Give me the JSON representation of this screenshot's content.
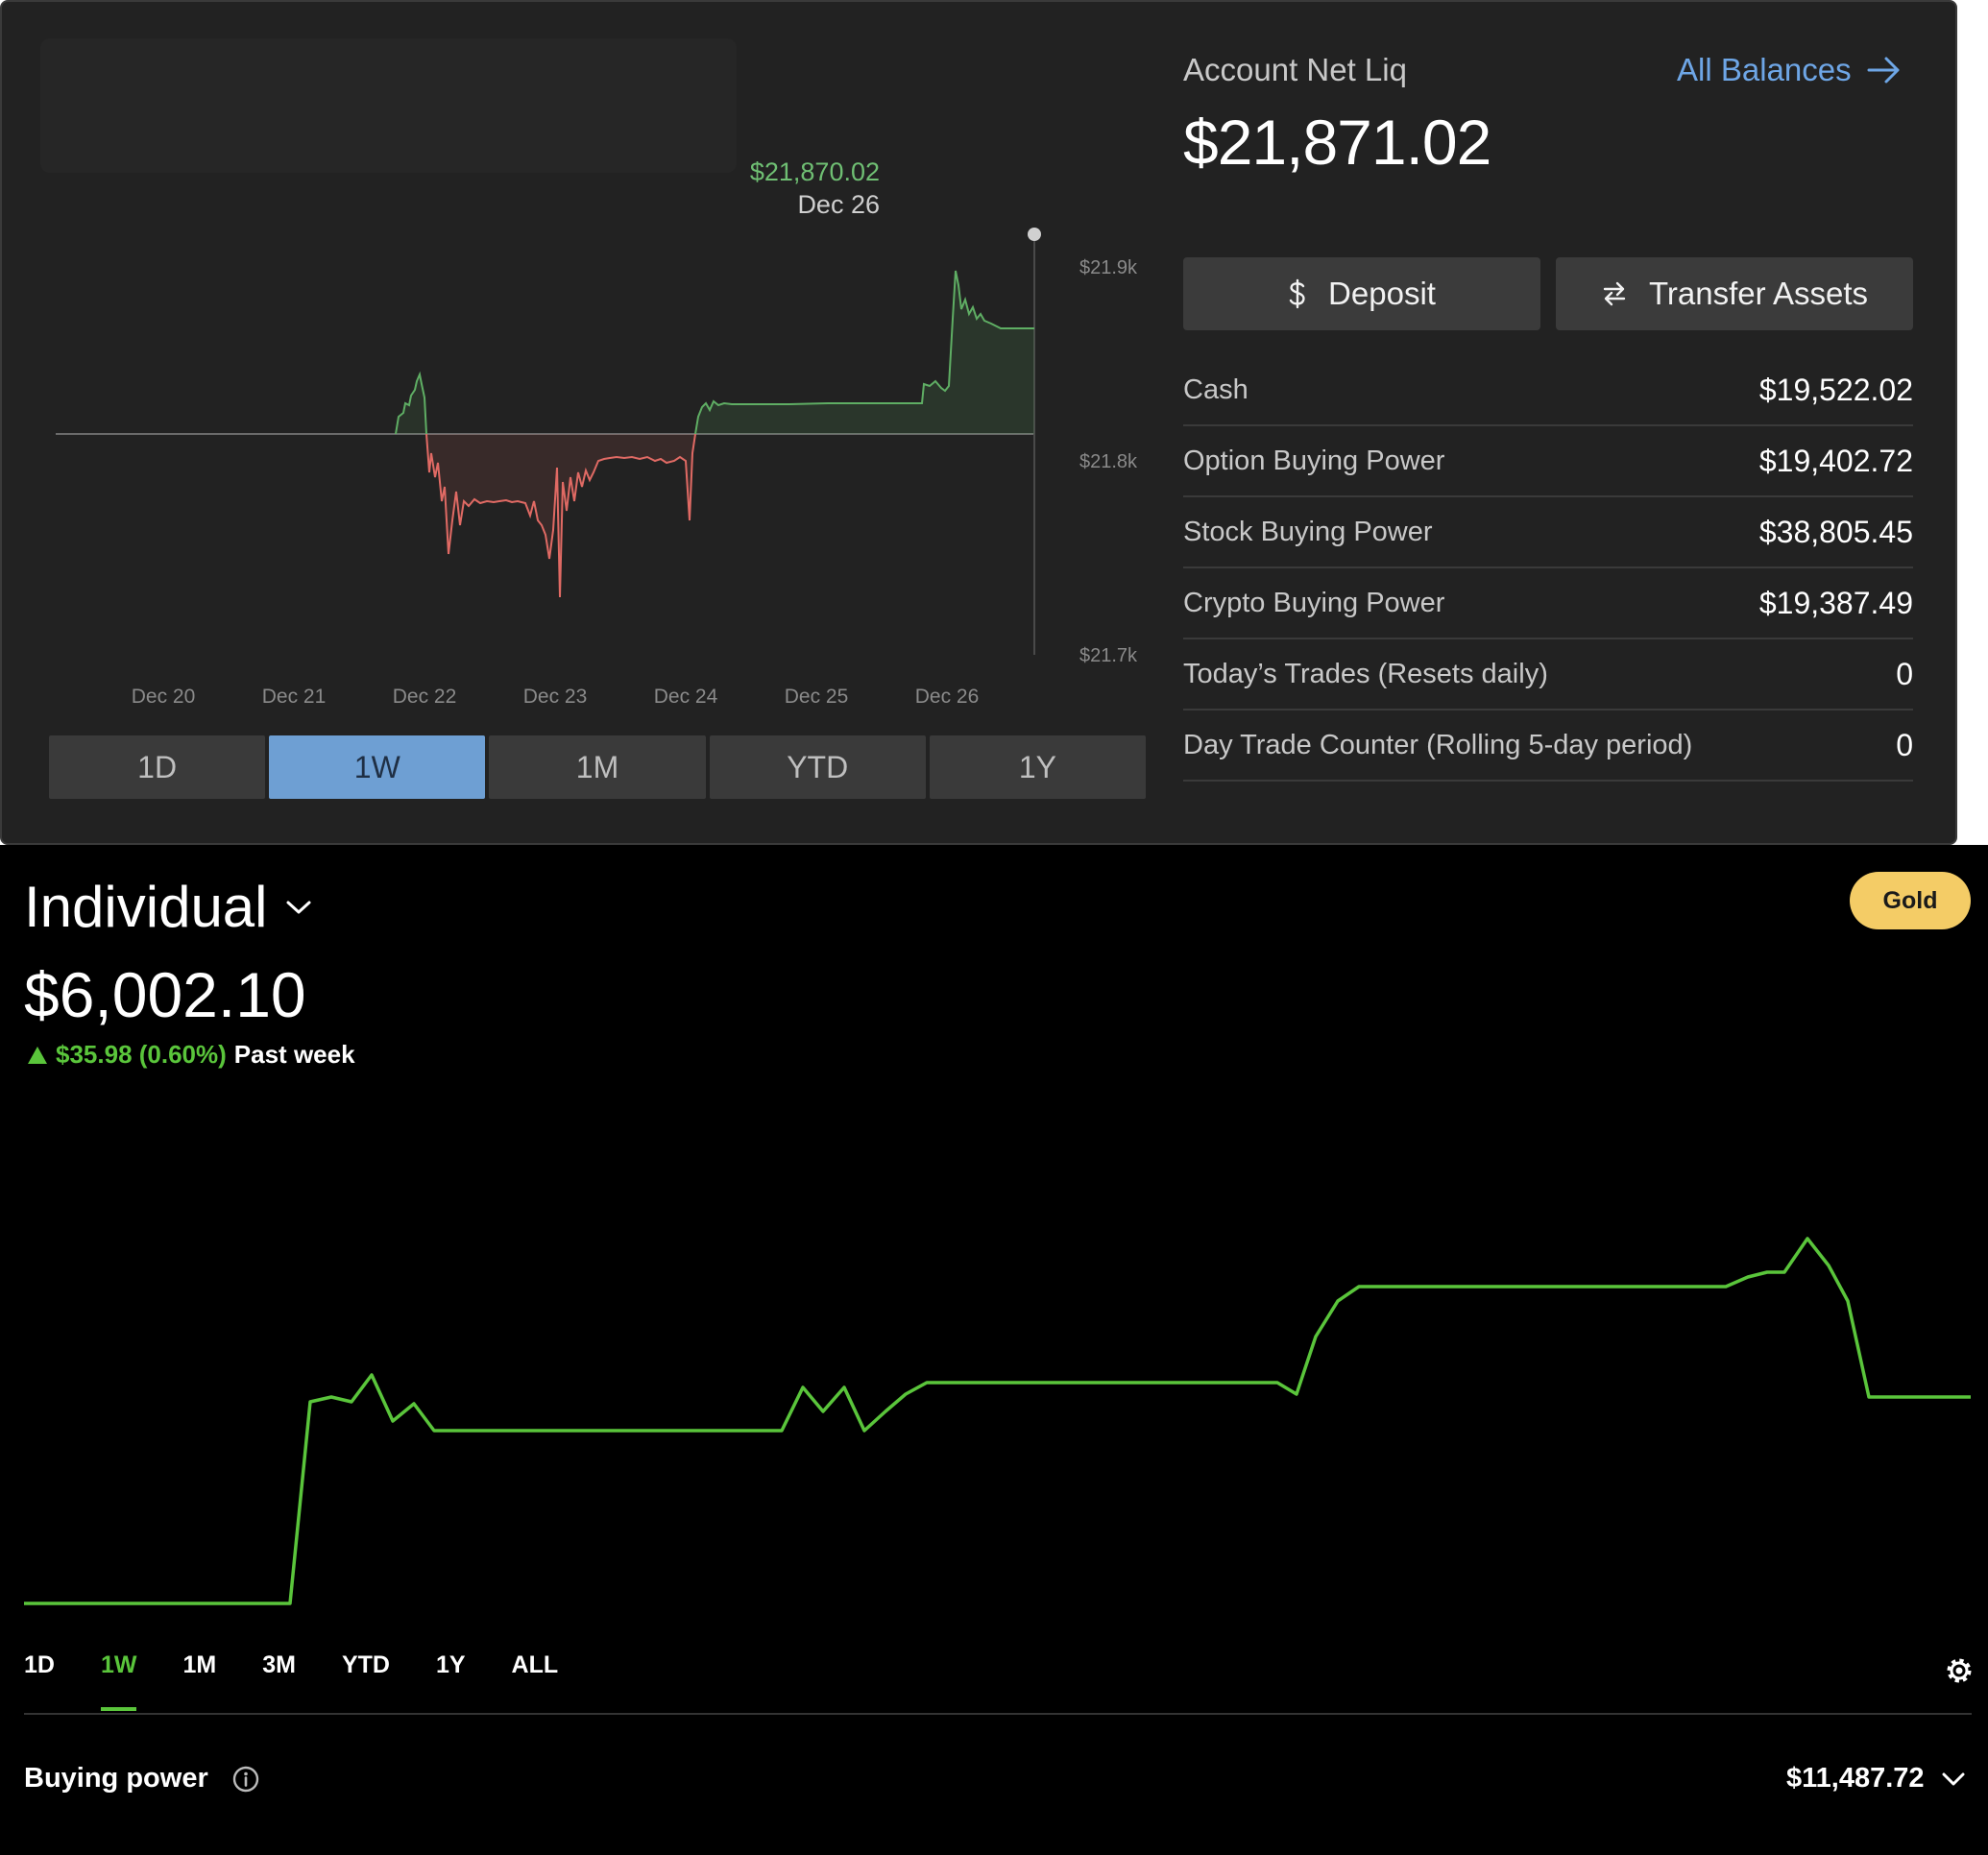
{
  "tastytrade": {
    "chart": {
      "hover_value": "$21,870.02",
      "hover_date": "Dec 26",
      "y_ticks": [
        "$21.9k",
        "$21.8k",
        "$21.7k"
      ],
      "x_ticks": [
        "Dec 20",
        "Dec 21",
        "Dec 22",
        "Dec 23",
        "Dec 24",
        "Dec 25",
        "Dec 26"
      ],
      "baseline_color": "#6a6a6a",
      "up_color": "#5fae64",
      "down_color": "#e06a64"
    },
    "range_buttons": [
      "1D",
      "1W",
      "1M",
      "YTD",
      "1Y"
    ],
    "active_range": "1W",
    "account_title": "Account Net Liq",
    "account_value": "$21,871.02",
    "all_balances": "All Balances",
    "deposit_label": "Deposit",
    "transfer_label": "Transfer Assets",
    "balances": [
      {
        "label": "Cash",
        "value": "$19,522.02"
      },
      {
        "label": "Option Buying Power",
        "value": "$19,402.72"
      },
      {
        "label": "Stock Buying Power",
        "value": "$38,805.45"
      },
      {
        "label": "Crypto Buying Power",
        "value": "$19,387.49"
      },
      {
        "label": "Today’s Trades (Resets daily)",
        "value": "0"
      },
      {
        "label": "Day Trade Counter (Rolling 5-day period)",
        "value": "0"
      }
    ]
  },
  "robinhood": {
    "account_name": "Individual",
    "value": "$6,002.10",
    "change": "$35.98 (0.60%)",
    "change_period": "Past week",
    "badge": "Gold",
    "line_color": "#5ac53b",
    "range_buttons": [
      "1D",
      "1W",
      "1M",
      "3M",
      "YTD",
      "1Y",
      "ALL"
    ],
    "active_range": "1W",
    "buying_power_label": "Buying power",
    "buying_power_value": "$11,487.72"
  },
  "icons": [
    "dollar-icon",
    "transfer-arrows-icon",
    "arrow-right-icon",
    "chevron-down-icon",
    "triangle-up-icon",
    "gear-icon",
    "info-icon"
  ]
}
